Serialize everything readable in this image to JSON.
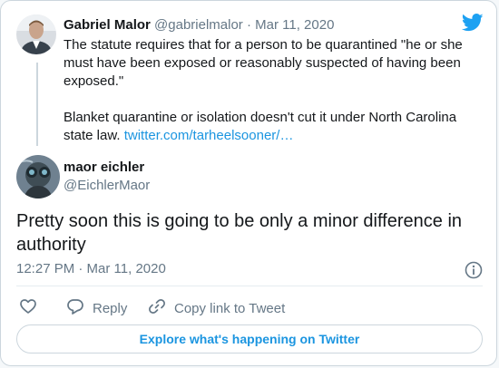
{
  "quoted_tweet": {
    "display_name": "Gabriel Malor",
    "handle": "@gabrielmalor",
    "separator": " · ",
    "date": "Mar 11, 2020",
    "paragraph_1": "The statute requires that for a person to be quarantined \"he or she must have been exposed or reasonably suspected of having been exposed.\"",
    "paragraph_2_text": "Blanket quarantine or isolation doesn't cut it under North Carolina state law. ",
    "paragraph_2_link": "twitter.com/tarheelsooner/…"
  },
  "tweet": {
    "display_name": "maor eichler",
    "handle": "@EichlerMaor",
    "text": "Pretty soon this is going to be only a minor difference in authority",
    "timestamp": "12:27 PM · Mar 11, 2020"
  },
  "actions": {
    "reply_label": "Reply",
    "copy_link_label": "Copy link to Tweet"
  },
  "explore_label": "Explore what's happening on Twitter",
  "colors": {
    "accent": "#1b95e0",
    "twitter_blue": "#1da1f2",
    "secondary_text": "#657786",
    "border": "#ccd6dd"
  },
  "icons": {
    "brand": "twitter-bird-icon",
    "like": "heart-icon",
    "reply": "speech-bubble-icon",
    "copy_link": "link-icon",
    "info": "info-icon"
  }
}
